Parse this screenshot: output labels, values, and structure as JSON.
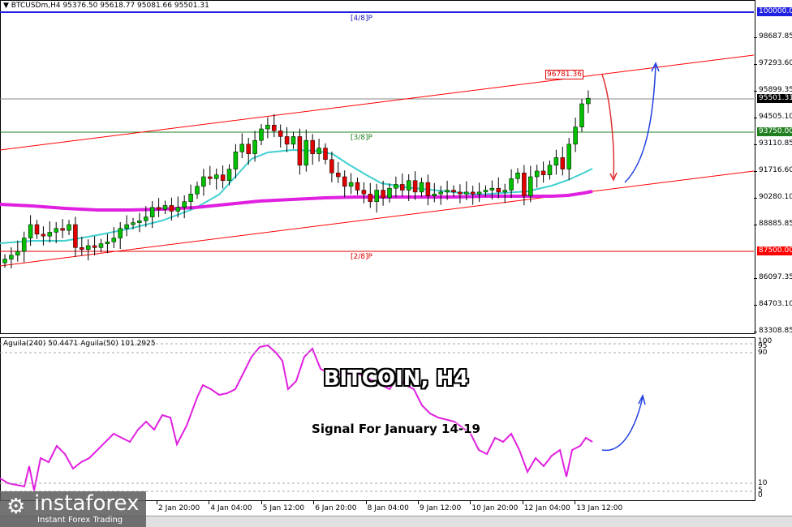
{
  "header": {
    "symbol_line": "BTCUSDm,H4  95376.50 95618.77 95081.66 95501.31"
  },
  "price_axis": {
    "labels": [
      "98687.85",
      "97293.60",
      "95899.35",
      "94505.10",
      "93110.85",
      "91716.60",
      "90280.10",
      "88885.85",
      "86097.35",
      "84703.10",
      "83308.85"
    ]
  },
  "tags": {
    "level_100000": "100000.0",
    "current": "95501.31",
    "level_93750": "93750.00",
    "level_87500": "87500.00"
  },
  "level_labels": {
    "p48": "[4/8]P",
    "p38": "[3/8]P",
    "p28": "[2/8]P"
  },
  "high_label": "96781.36",
  "indicator": {
    "legend": "Aguila(240) 50.4471  Aguila(50) 101.2925",
    "axis": [
      "100",
      "95",
      "90",
      "10",
      "5",
      "0"
    ]
  },
  "overlay": {
    "title": "BITCOIN, H4",
    "signal": "Signal For January 14-19"
  },
  "time_axis": [
    "2 Jan 20:00",
    "4 Jan 04:00",
    "5 Jan 12:00",
    "6 Jan 20:00",
    "8 Jan 04:00",
    "9 Jan 12:00",
    "10 Jan 20:00",
    "12 Jan 04:00",
    "13 Jan 12:00"
  ],
  "logo": {
    "name": "instaforex",
    "tagline": "Instant Forex Trading"
  },
  "colors": {
    "bull": "#00c000",
    "bear": "#e00000",
    "ma_slow": "#e020e0",
    "ma_fast": "#40d0d0",
    "channel": "#ff0000",
    "up_arrow": "#2040e0",
    "down_arrow": "#e03030"
  },
  "chart_data": {
    "type": "candlestick",
    "ylim": [
      83308.85,
      100000
    ],
    "closes": [
      87100,
      87300,
      87500,
      88200,
      88900,
      88400,
      88300,
      88500,
      88700,
      88600,
      88900,
      87700,
      87600,
      87800,
      87700,
      87900,
      88000,
      88200,
      88700,
      88900,
      89000,
      89100,
      89300,
      89800,
      89700,
      89900,
      89600,
      89800,
      90100,
      90500,
      90900,
      91400,
      91300,
      91500,
      91200,
      91800,
      92700,
      93100,
      92600,
      93300,
      93900,
      94100,
      93800,
      93500,
      93100,
      93500,
      92000,
      93300,
      92600,
      92900,
      92300,
      91600,
      91400,
      90900,
      91100,
      90700,
      90500,
      90100,
      90700,
      90300,
      90800,
      91000,
      90700,
      91200,
      90600,
      91100,
      90400,
      90500,
      90600,
      90700,
      90600,
      90500,
      90600,
      90500,
      90600,
      90700,
      90800,
      90600,
      90700,
      91300,
      91600,
      90400,
      91400,
      91700,
      91500,
      92000,
      92400,
      91800,
      93100,
      94000,
      95213,
      95501
    ]
  }
}
